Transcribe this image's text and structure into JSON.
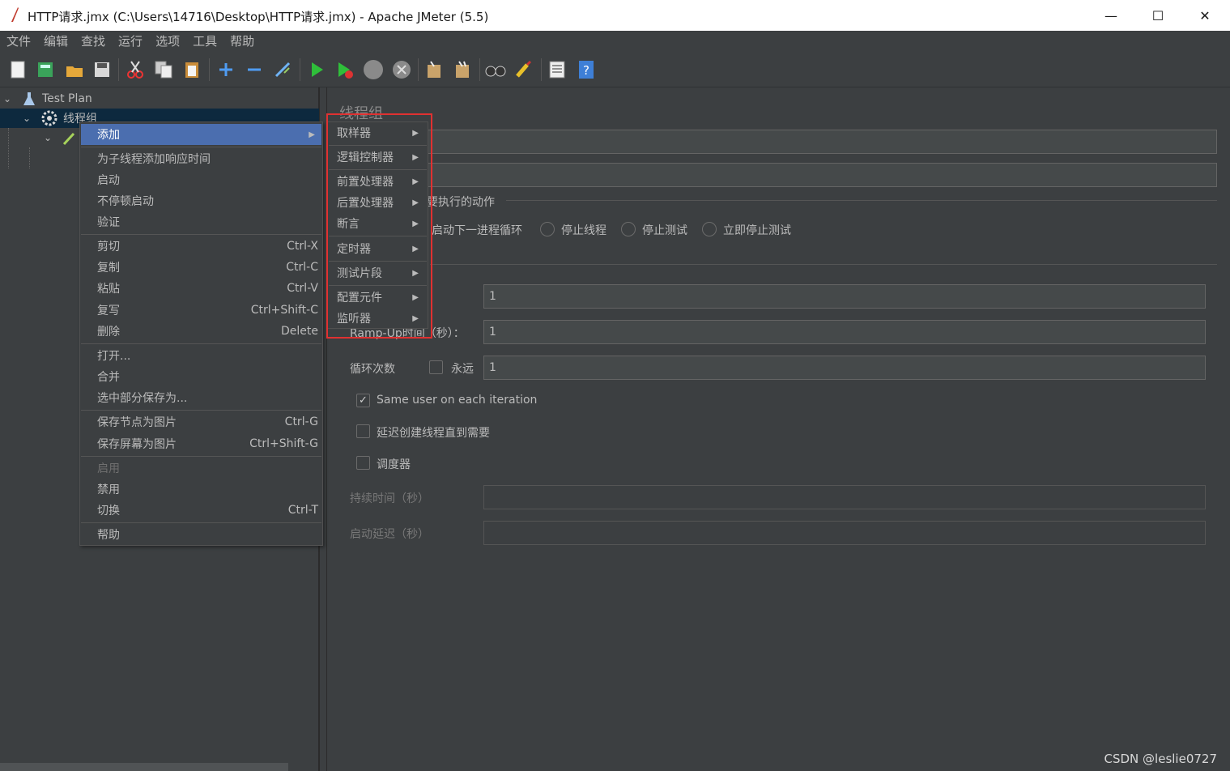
{
  "window": {
    "title": "HTTP请求.jmx (C:\\Users\\14716\\Desktop\\HTTP请求.jmx) - Apache JMeter (5.5)",
    "controls": {
      "minimize": "—",
      "maximize": "☐",
      "close": "✕"
    }
  },
  "menubar": [
    "文件",
    "编辑",
    "查找",
    "运行",
    "选项",
    "工具",
    "帮助"
  ],
  "toolbar": {
    "icons": [
      "new-icon",
      "templates-icon",
      "open-icon",
      "save-icon",
      "cut-icon",
      "copy-icon",
      "paste-icon",
      "expand-icon",
      "collapse-icon",
      "toggle-icon",
      "start-icon",
      "start-no-pause-icon",
      "stop-icon",
      "shutdown-icon",
      "clear-icon",
      "clear-all-icon",
      "search-icon",
      "reset-search-icon",
      "function-helper-icon",
      "help-icon"
    ]
  },
  "tree": {
    "test_plan": "Test Plan",
    "thread_group": "线程组"
  },
  "panel": {
    "title": "线程组",
    "error_action_label": "要执行的动作",
    "radio_options": [
      "启动下一进程循环",
      "停止线程",
      "停止测试",
      "立即停止测试"
    ],
    "threads_value": "1",
    "rampup_label": "Ramp-Up时间（秒）：",
    "rampup_value": "1",
    "loop_label": "循环次数",
    "forever_label": "永远",
    "loop_value": "1",
    "same_user_label": "Same user on each iteration",
    "delay_label": "延迟创建线程直到需要",
    "scheduler_label": "调度器",
    "duration_label": "持续时间（秒）",
    "startup_delay_label": "启动延迟（秒）"
  },
  "context_menu": {
    "items": [
      {
        "label": "添加",
        "shortcut": "▶"
      },
      {
        "label": "为子线程添加响应时间",
        "shortcut": ""
      },
      {
        "label": "启动",
        "shortcut": ""
      },
      {
        "label": "不停顿启动",
        "shortcut": ""
      },
      {
        "label": "验证",
        "shortcut": ""
      },
      {
        "label": "剪切",
        "shortcut": "Ctrl-X"
      },
      {
        "label": "复制",
        "shortcut": "Ctrl-C"
      },
      {
        "label": "粘贴",
        "shortcut": "Ctrl-V"
      },
      {
        "label": "复写",
        "shortcut": "Ctrl+Shift-C"
      },
      {
        "label": "删除",
        "shortcut": "Delete"
      },
      {
        "label": "打开...",
        "shortcut": ""
      },
      {
        "label": "合并",
        "shortcut": ""
      },
      {
        "label": "选中部分保存为...",
        "shortcut": ""
      },
      {
        "label": "保存节点为图片",
        "shortcut": "Ctrl-G"
      },
      {
        "label": "保存屏幕为图片",
        "shortcut": "Ctrl+Shift-G"
      },
      {
        "label": "启用",
        "shortcut": ""
      },
      {
        "label": "禁用",
        "shortcut": ""
      },
      {
        "label": "切换",
        "shortcut": "Ctrl-T"
      },
      {
        "label": "帮助",
        "shortcut": ""
      }
    ]
  },
  "submenu": {
    "items": [
      "取样器",
      "逻辑控制器",
      "前置处理器",
      "后置处理器",
      "断言",
      "定时器",
      "测试片段",
      "配置元件",
      "监听器"
    ],
    "arrow": "▶"
  },
  "watermark": "CSDN @leslie0727"
}
